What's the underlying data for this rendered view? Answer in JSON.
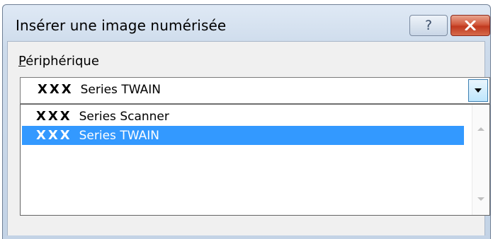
{
  "dialog": {
    "title": "Insérer une image numérisée",
    "help_label": "?",
    "close_label": "×"
  },
  "device": {
    "label_underlined": "P",
    "label_rest": "ériphérique",
    "selected": {
      "brand": "XXX",
      "text": "Series TWAIN"
    },
    "options": [
      {
        "brand": "XXX",
        "text": "Series Scanner",
        "selected": false
      },
      {
        "brand": "XXX",
        "text": "Series TWAIN",
        "selected": true
      }
    ]
  },
  "colors": {
    "selection": "#3399ff",
    "close_button": "#c0391f"
  }
}
